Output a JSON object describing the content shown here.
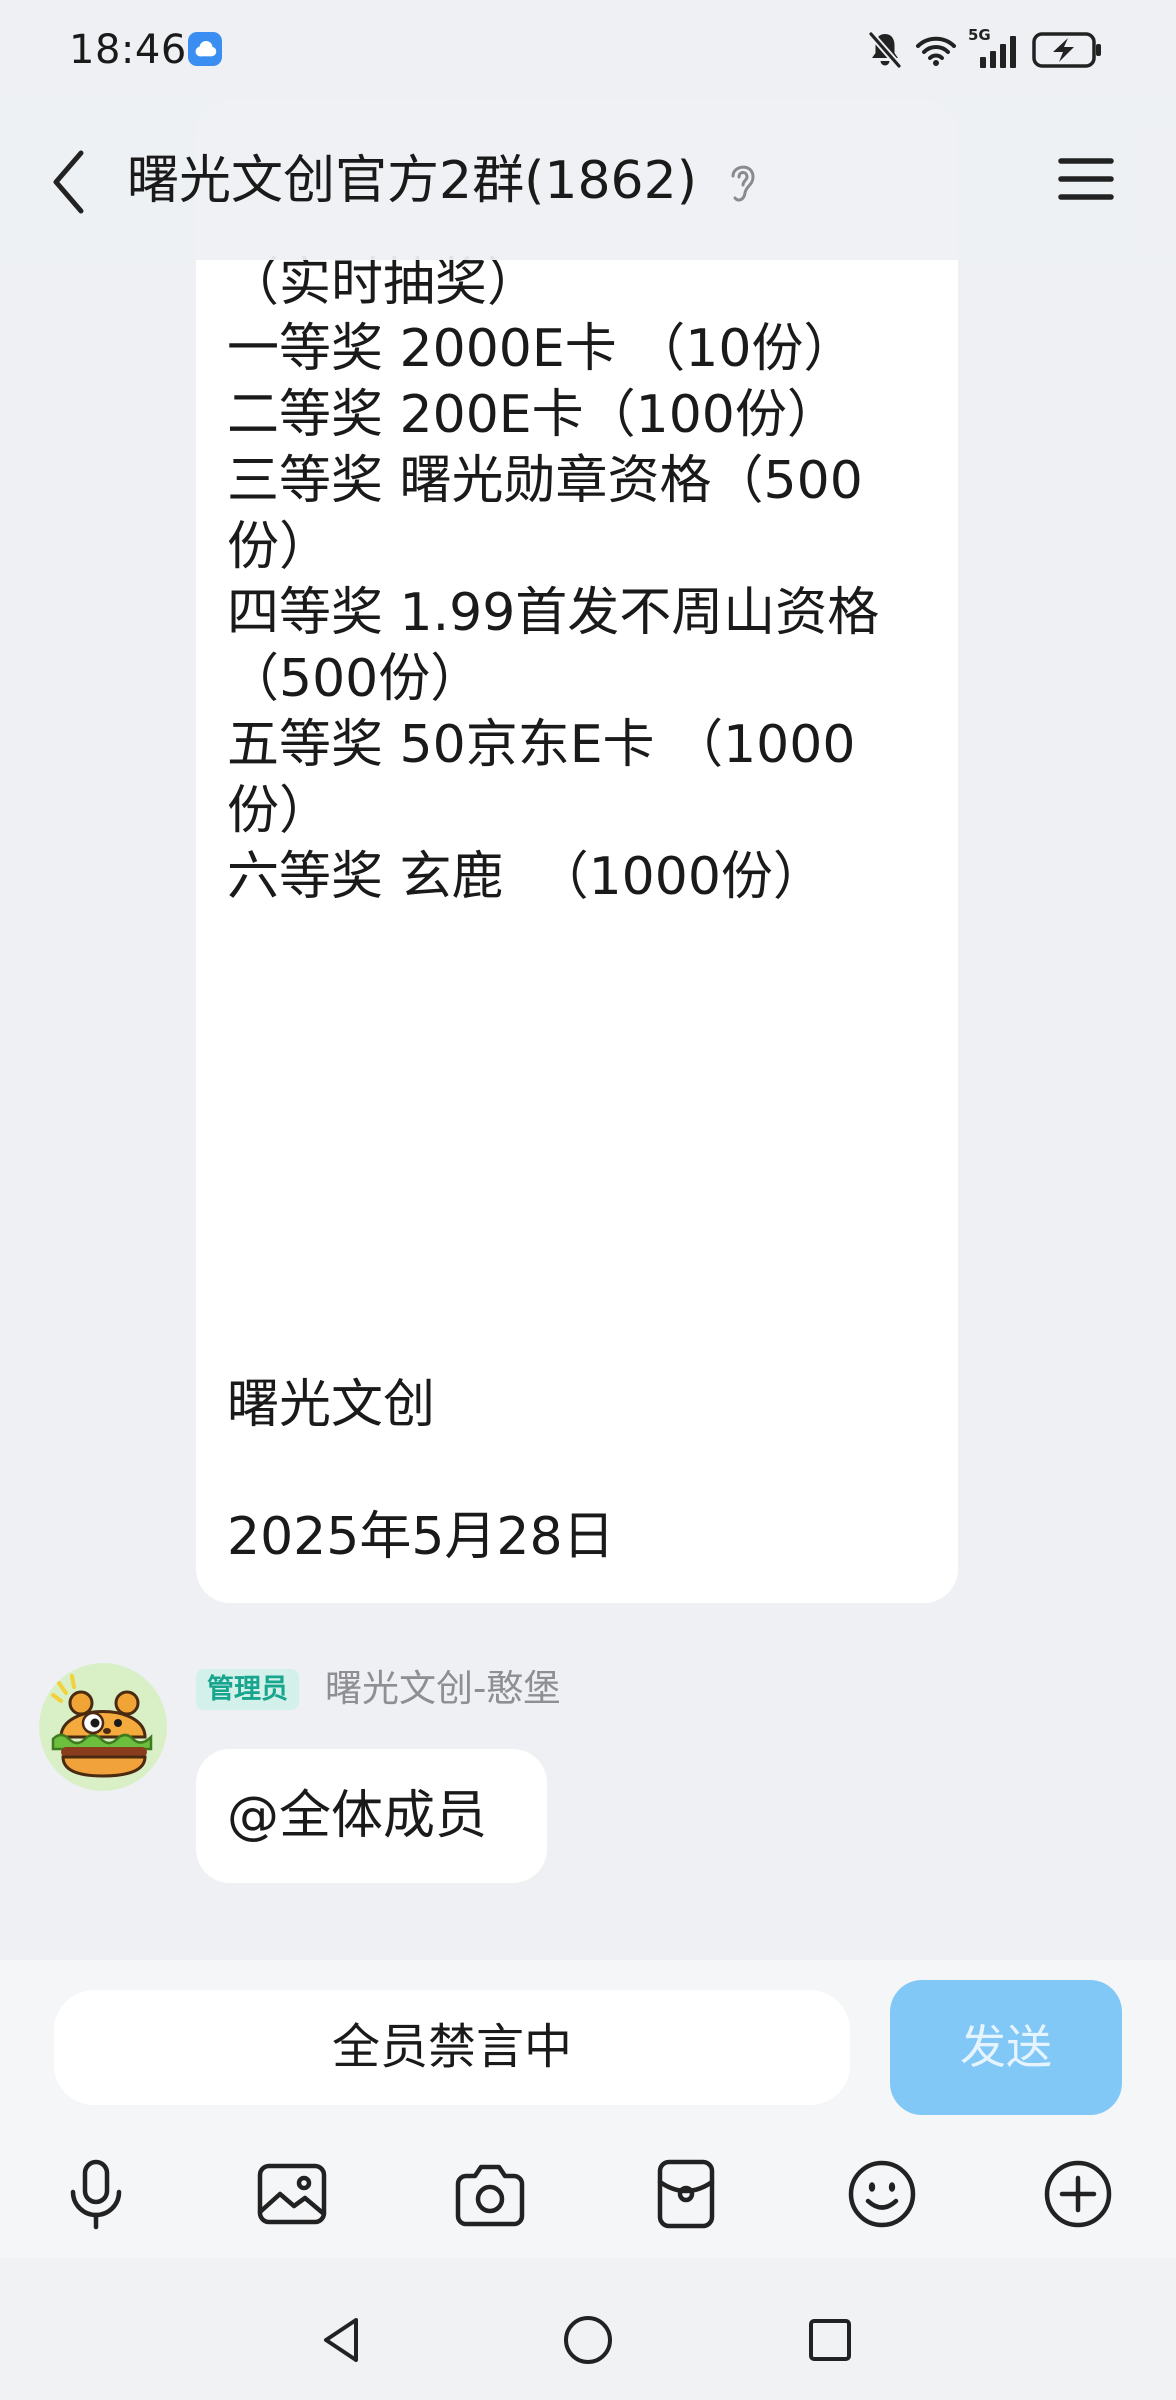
{
  "status_bar": {
    "time": "18:46",
    "network": "5G",
    "icons": [
      "cloud-icon",
      "mute-icon",
      "wifi-icon",
      "signal-icon",
      "battery-charging-icon"
    ]
  },
  "header": {
    "title": "曙光文创官方2群(1862)",
    "icons": [
      "back-chevron-icon",
      "ear-icon",
      "menu-icon"
    ]
  },
  "messages": [
    {
      "type": "text",
      "lines": [
        "（实时抽奖）",
        "一等奖 2000E卡 （10份）",
        "二等奖 200E卡（100份）",
        "三等奖 曙光勋章资格（500",
        "份）",
        "四等奖 1.99首发不周山资格",
        "（500份）",
        "五等奖 50京东E卡 （1000",
        "份）",
        "六等奖 玄鹿  （1000份）",
        "",
        "",
        "",
        "",
        "",
        "",
        "",
        "曙光文创",
        "",
        "2025年5月28日"
      ]
    },
    {
      "type": "text",
      "sender": {
        "role_badge": "管理员",
        "name": "曙光文创-憨堡",
        "avatar": "burger-bear-avatar"
      },
      "text": "@全体成员"
    }
  ],
  "composer": {
    "input_text": "全员禁言中",
    "send_label": "发送",
    "send_enabled": false
  },
  "toolbar": {
    "items": [
      "mic-icon",
      "image-icon",
      "camera-icon",
      "red-packet-icon",
      "emoji-icon",
      "plus-icon"
    ]
  },
  "nav_bar": {
    "items": [
      "nav-back-icon",
      "nav-home-icon",
      "nav-recents-icon"
    ]
  },
  "colors": {
    "chat_background": "#eef0f3",
    "bubble": "#ffffff",
    "text": "#1a1a1a",
    "send_button": "#82c8f6",
    "send_button_text": "#e6f4ff",
    "admin_badge_background": "#d3f1ea",
    "admin_badge_text": "#17a58e",
    "sender_name": "#8e8e93",
    "composer_background": "#f5f6f8"
  }
}
